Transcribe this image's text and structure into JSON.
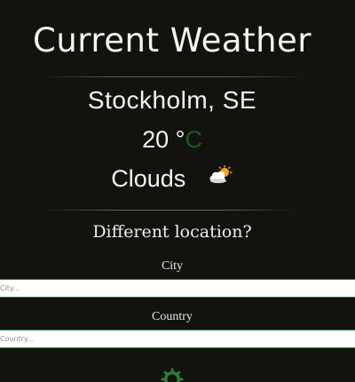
{
  "header": {
    "title": "Current Weather"
  },
  "weather": {
    "location": "Stockholm, SE",
    "temperature": "20",
    "degree_symbol": "°",
    "unit": "C",
    "condition": "Clouds",
    "condition_icon": "partly-cloudy-icon"
  },
  "search": {
    "question": "Different location?",
    "city_label": "City",
    "city_placeholder": "City...",
    "city_value": "",
    "country_label": "Country",
    "country_placeholder": "Country...",
    "country_value": ""
  },
  "colors": {
    "background": "#12120f",
    "text": "#f4f4ef",
    "unit_accent": "#1d5a24",
    "input_border": "#2d8a2d",
    "spinner": "#2e7d32"
  },
  "submit": {
    "icon": "loading-spinner-icon"
  }
}
